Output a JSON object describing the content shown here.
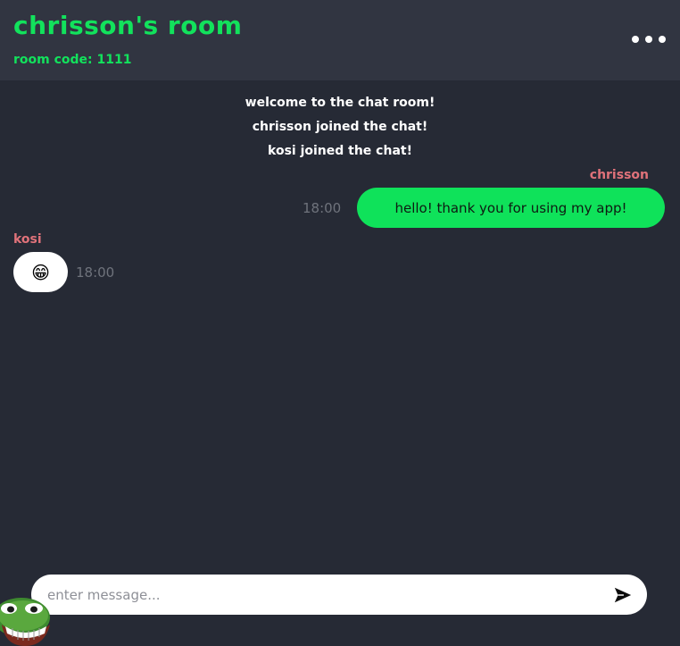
{
  "header": {
    "title": "chrisson's room",
    "room_code": "room code: 1111",
    "menu_icon": "more-horizontal-icon"
  },
  "system_messages": [
    "welcome to the chat room!",
    "chrisson joined the chat!",
    "kosi joined the chat!"
  ],
  "messages": [
    {
      "sender": "chrisson",
      "text": "hello! thank you for using my app!",
      "time": "18:00",
      "own": true
    },
    {
      "sender": "kosi",
      "text": "😁",
      "time": "18:00",
      "own": false
    }
  ],
  "composer": {
    "placeholder": "enter message...",
    "value": "",
    "send_icon": "send-icon"
  },
  "sticker": {
    "icon": "pepe-grin-sticker-icon"
  },
  "colors": {
    "accent": "#12e25c",
    "own_bubble": "#0fe25a",
    "other_bubble": "#ffffff",
    "sender_name": "#e0727a",
    "header_bg": "#313541",
    "chat_bg": "#262a35",
    "timestamp": "#6f737c"
  }
}
